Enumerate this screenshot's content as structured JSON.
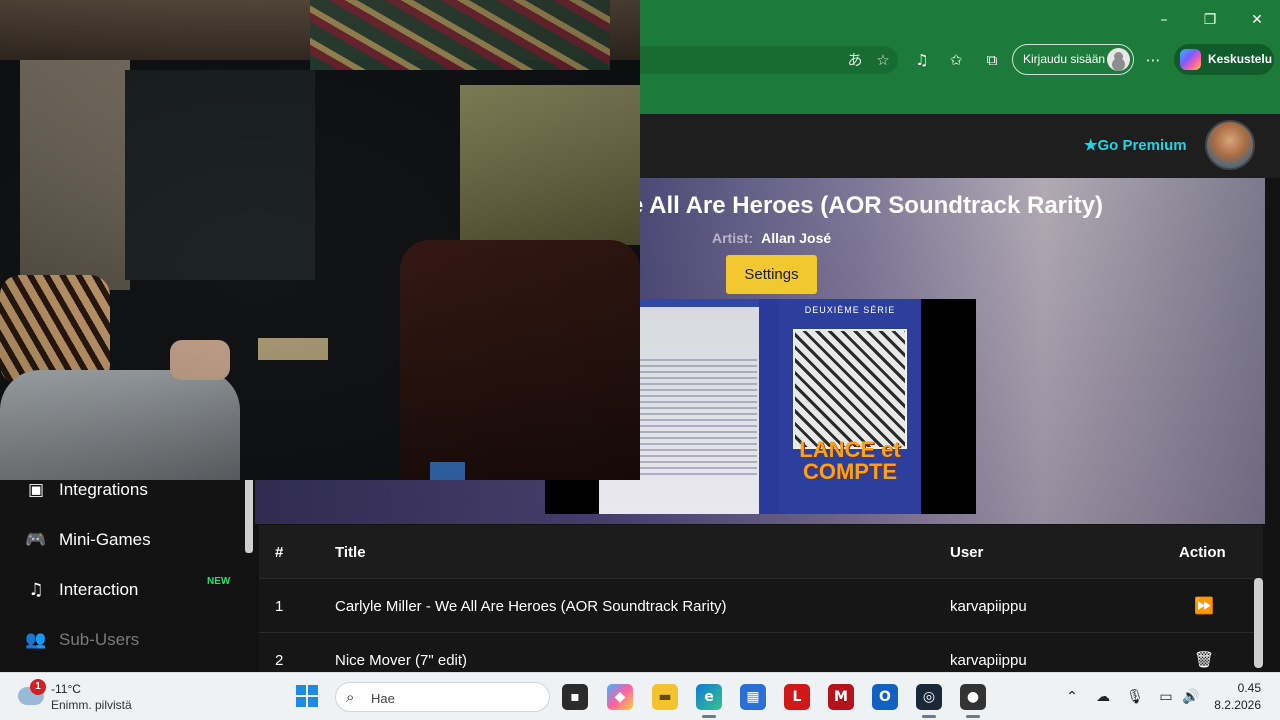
{
  "browser": {
    "window_controls": {
      "minimize": "–",
      "restore": "❐",
      "close": "✕"
    },
    "signin_label": "Kirjaudu sisään",
    "chat_label": "Keskustelu",
    "colors": {
      "chrome": "#1c7a3a"
    }
  },
  "site": {
    "premium_label": "Go Premium",
    "premium_color": "#22d3e6"
  },
  "now_playing": {
    "title": "e All Are Heroes (AOR Soundtrack Rarity)",
    "artist_label": "Artist:",
    "artist": "Allan José",
    "settings_label": "Settings",
    "cover": {
      "series": "DEUXIÈME SÉRIE",
      "logo": "LANCE et COMPTE"
    }
  },
  "sidebar": {
    "items": [
      {
        "label": "Integrations",
        "icon": "chat-bubble-icon"
      },
      {
        "label": "Mini-Games",
        "icon": "gamepad-icon"
      },
      {
        "label": "Interaction",
        "icon": "music-note-icon",
        "badge": "NEW"
      },
      {
        "label": "Sub-Users",
        "icon": "users-icon",
        "disabled": true
      }
    ]
  },
  "queue": {
    "columns": [
      "#",
      "Title",
      "User",
      "Action"
    ],
    "rows": [
      {
        "num": "1",
        "title": "Carlyle Miller - We All Are Heroes (AOR Soundtrack Rarity)",
        "user": "karvapiippu",
        "action": "skip"
      },
      {
        "num": "2",
        "title": "Nice Mover (7\" edit)",
        "user": "karvapiippu",
        "action": "delete"
      }
    ]
  },
  "taskbar": {
    "weather_badge": "1",
    "temperature": "-11°C",
    "weather_desc": "Enimm. pilvistä",
    "search_placeholder": "Hae",
    "time": "0.45",
    "date": "8.2.2026"
  }
}
